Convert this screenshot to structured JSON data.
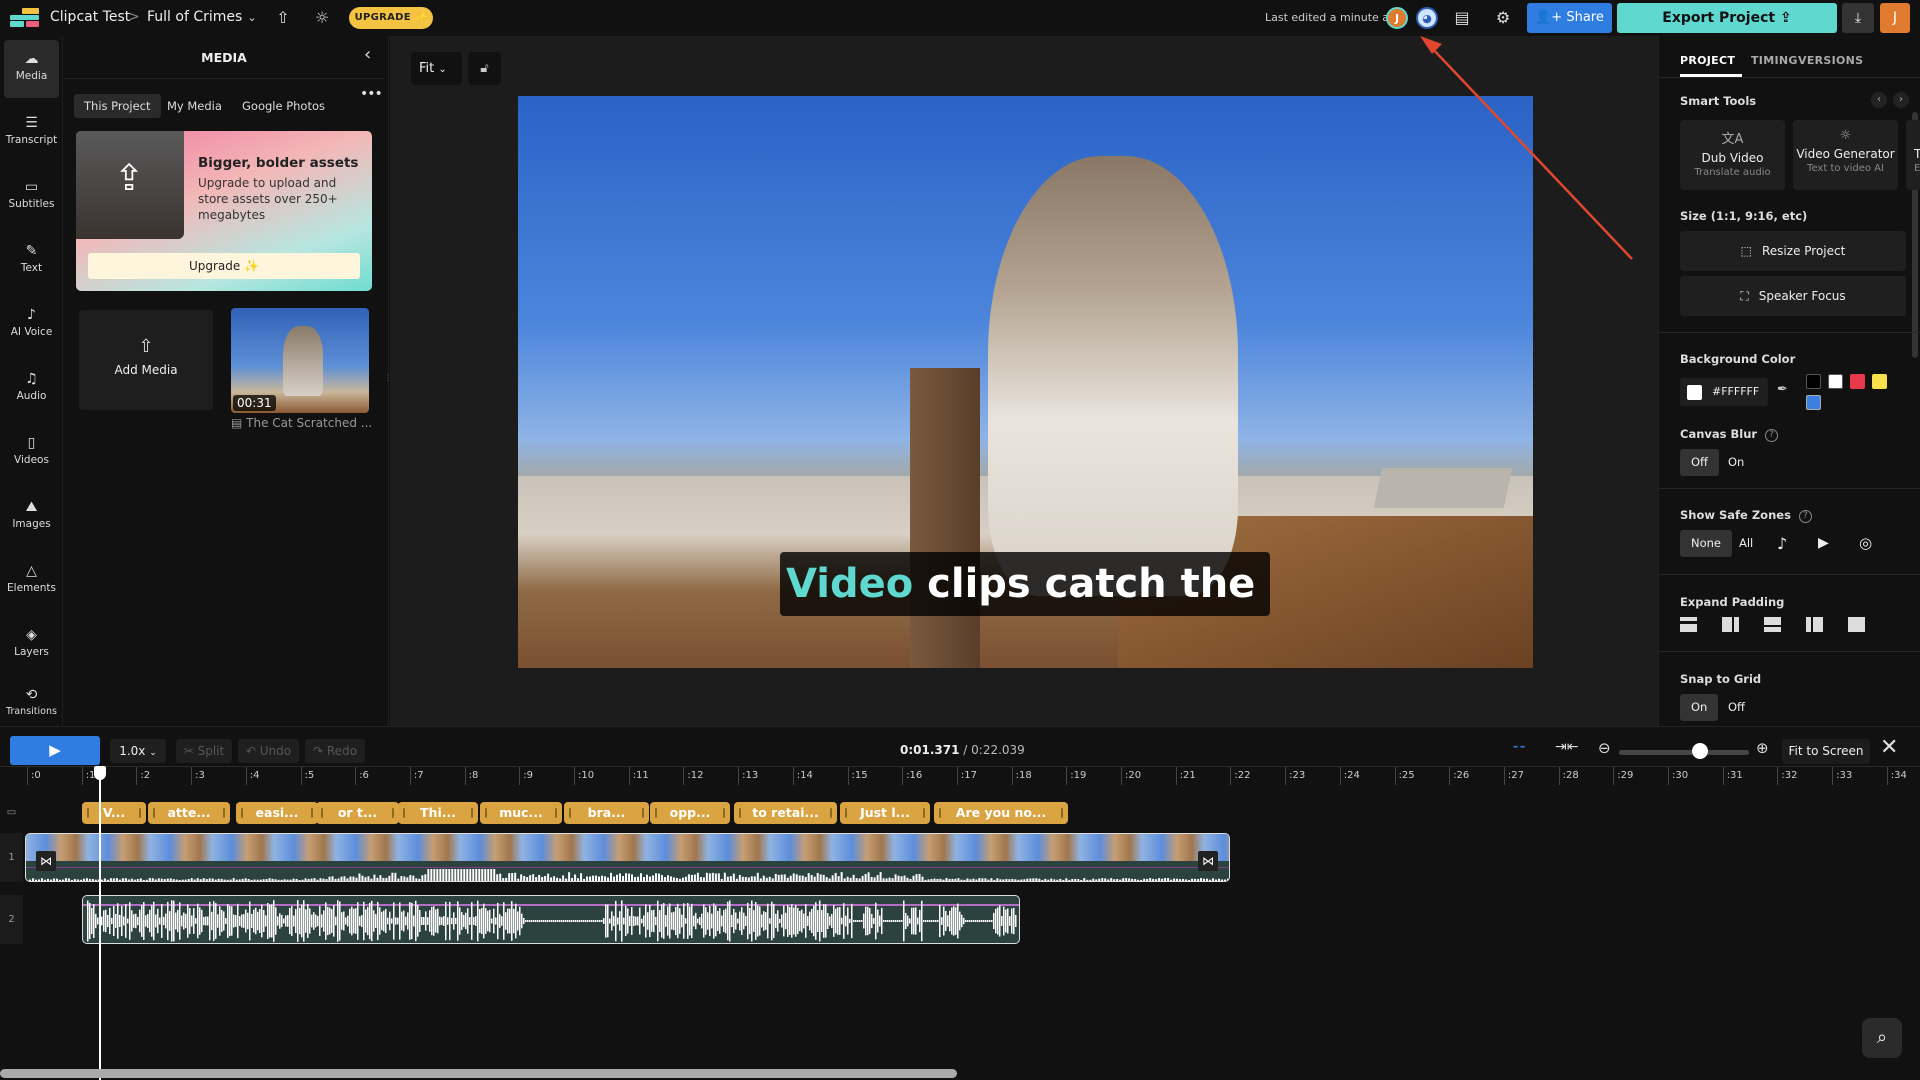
{
  "topbar": {
    "workspace": "Clipcat Test",
    "breadcrumb_sep": ">",
    "project": "Full of Crimes",
    "upgrade": "UPGRADE ✨",
    "last_edited": "Last edited a minute ago",
    "avatar_initial": "J",
    "share": "Share",
    "export": "Export Project",
    "user_initial": "J",
    "icons": [
      "logo-icon",
      "chevron-down-icon",
      "upload-icon",
      "lightbulb-icon",
      "comment-icon",
      "gear-icon",
      "download-icon"
    ]
  },
  "leftnav": {
    "items": [
      {
        "label": "Media",
        "icon": "cloud-upload-icon",
        "active": true
      },
      {
        "label": "Transcript",
        "icon": "transcript-icon"
      },
      {
        "label": "Subtitles",
        "icon": "subtitles-icon"
      },
      {
        "label": "Text",
        "icon": "text-edit-icon"
      },
      {
        "label": "AI Voice",
        "icon": "ai-voice-icon"
      },
      {
        "label": "Audio",
        "icon": "music-note-icon"
      },
      {
        "label": "Videos",
        "icon": "film-icon"
      },
      {
        "label": "Images",
        "icon": "image-icon"
      },
      {
        "label": "Elements",
        "icon": "shapes-icon"
      },
      {
        "label": "Layers",
        "icon": "layers-icon"
      },
      {
        "label": "Transitions",
        "icon": "transitions-icon"
      }
    ]
  },
  "media": {
    "title": "MEDIA",
    "tabs": [
      "This Project",
      "My Media",
      "Google Photos"
    ],
    "active_tab": "This Project",
    "promo": {
      "title": "Bigger, bolder assets",
      "body": "Upgrade to upload and store assets over 250+ megabytes",
      "button": "Upgrade ✨"
    },
    "add_media": "Add Media",
    "items": [
      {
        "name": "The Cat Scratched ...",
        "duration": "00:31"
      }
    ]
  },
  "stage": {
    "fit": "Fit",
    "caption_highlight": "Video",
    "caption_rest": " clips catch the"
  },
  "right": {
    "tabs": [
      "PROJECT",
      "TIMING",
      "VERSIONS"
    ],
    "active_tab": "PROJECT",
    "smart_tools": {
      "heading": "Smart Tools",
      "cards": [
        {
          "title": "Dub Video",
          "subtitle": "Translate audio",
          "icon": "translate-icon"
        },
        {
          "title": "Video Generator",
          "subtitle": "Text to video AI",
          "icon": "lightbulb-icon"
        },
        {
          "title": "T",
          "subtitle": "E",
          "icon": ""
        }
      ]
    },
    "size": {
      "heading": "Size (1:1, 9:16, etc)",
      "resize": "Resize Project",
      "speaker_focus": "Speaker Focus"
    },
    "background": {
      "heading": "Background Color",
      "value": "#FFFFFF",
      "swatches": [
        "#000000",
        "#FFFFFF",
        "#E8384B",
        "#F7E04B",
        "#3B7FE0"
      ]
    },
    "canvas_blur": {
      "heading": "Canvas Blur",
      "options": [
        "Off",
        "On"
      ],
      "selected": "Off"
    },
    "safe_zones": {
      "heading": "Show Safe Zones",
      "options": [
        "None",
        "All"
      ],
      "selected": "None",
      "icons": [
        "tiktok-icon",
        "youtube-icon",
        "instagram-icon"
      ]
    },
    "expand_padding": {
      "heading": "Expand Padding"
    },
    "snap_grid": {
      "heading": "Snap to Grid",
      "options": [
        "On",
        "Off"
      ],
      "selected": "On"
    }
  },
  "timeline": {
    "speed": "1.0x",
    "split": "✂ Split",
    "undo": "↶ Undo",
    "redo": "↷ Redo",
    "current_time": "0:01.371",
    "total_time": " / 0:22.039",
    "fit_to_screen": "Fit to Screen",
    "zoom_level": 0.62,
    "ruler": [
      ":0",
      ":1",
      ":2",
      ":3",
      ":4",
      ":5",
      ":6",
      ":7",
      ":8",
      ":9",
      ":10",
      ":11",
      ":12",
      ":13",
      ":14",
      ":15",
      ":16",
      ":17",
      ":18",
      ":19",
      ":20",
      ":21",
      ":22",
      ":23",
      ":24",
      ":25",
      ":26",
      ":27",
      ":28",
      ":29",
      ":30",
      ":31",
      ":32",
      ":33",
      ":34"
    ],
    "track_labels": [
      "1",
      "2"
    ],
    "subtitles": [
      "V...",
      "atte...",
      "easi...",
      "or t...",
      "Thi...",
      "muc...",
      "bra...",
      "opp...",
      "to retai...",
      "Just l...",
      "Are you no..."
    ]
  }
}
